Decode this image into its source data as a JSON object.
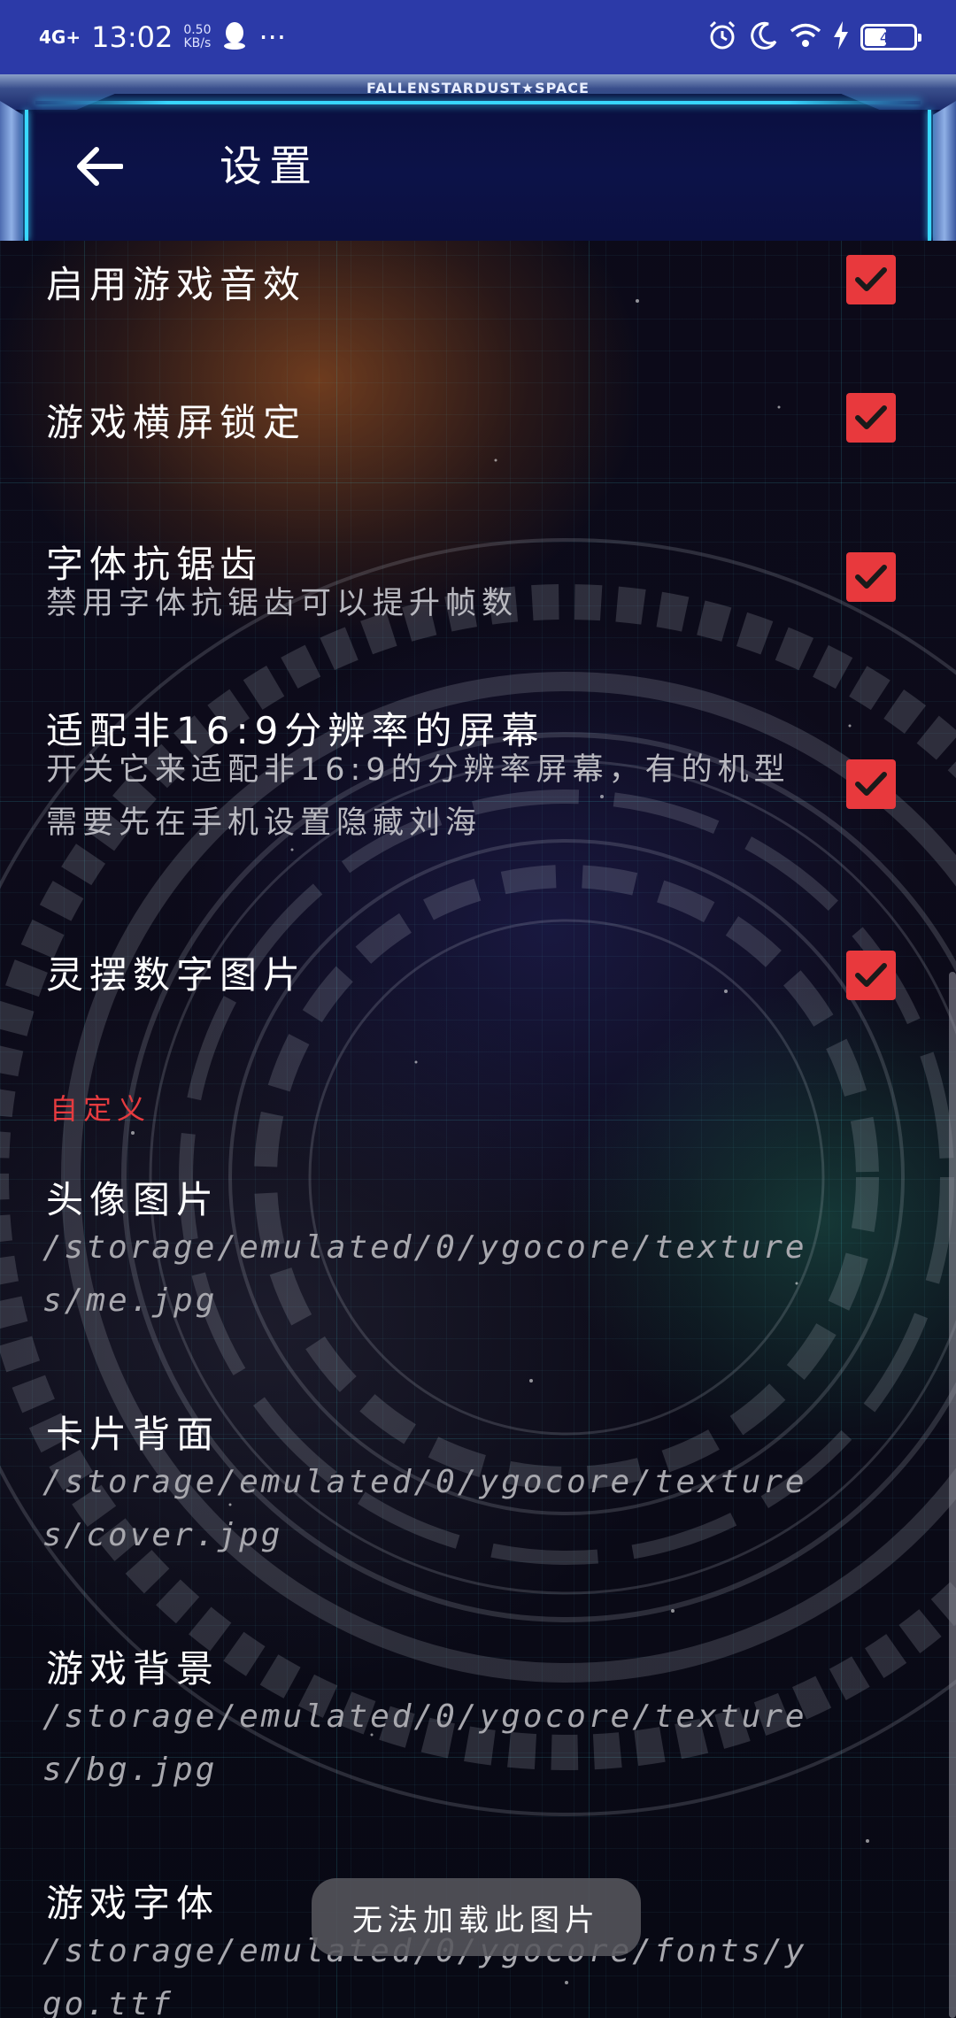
{
  "status_bar": {
    "network": "4G+",
    "time": "13:02",
    "speed_value": "0.50",
    "speed_unit": "KB/s",
    "more": "···",
    "battery_level": "41"
  },
  "header": {
    "brand": "FALLENSTARDUST★SPACE",
    "title": "设置",
    "back_icon": "arrow-left-icon"
  },
  "settings": [
    {
      "title": "启用游戏音效",
      "checked": true
    },
    {
      "title": "游戏横屏锁定",
      "checked": true
    },
    {
      "title": "字体抗锯齿",
      "subtitle": "禁用字体抗锯齿可以提升帧数",
      "checked": true
    },
    {
      "title": "适配非16:9分辨率的屏幕",
      "subtitle": "开关它来适配非16:9的分辨率屏幕，有的机型需要先在手机设置隐藏刘海",
      "checked": true
    },
    {
      "title": "灵摆数字图片",
      "checked": true
    }
  ],
  "custom_section": {
    "header": "自定义",
    "items": [
      {
        "title": "头像图片",
        "path": "/storage/emulated/0/ygocore/textures/me.jpg"
      },
      {
        "title": "卡片背面",
        "path": "/storage/emulated/0/ygocore/textures/cover.jpg"
      },
      {
        "title": "游戏背景",
        "path": "/storage/emulated/0/ygocore/textures/bg.jpg"
      },
      {
        "title": "游戏字体",
        "path": "/storage/emulated/0/ygocore/fonts/ygo.ttf"
      }
    ]
  },
  "toast": "无法加载此图片",
  "colors": {
    "accent": "#e8393d",
    "status_bar": "#2c3aa8",
    "section_header": "#e63b3f"
  }
}
